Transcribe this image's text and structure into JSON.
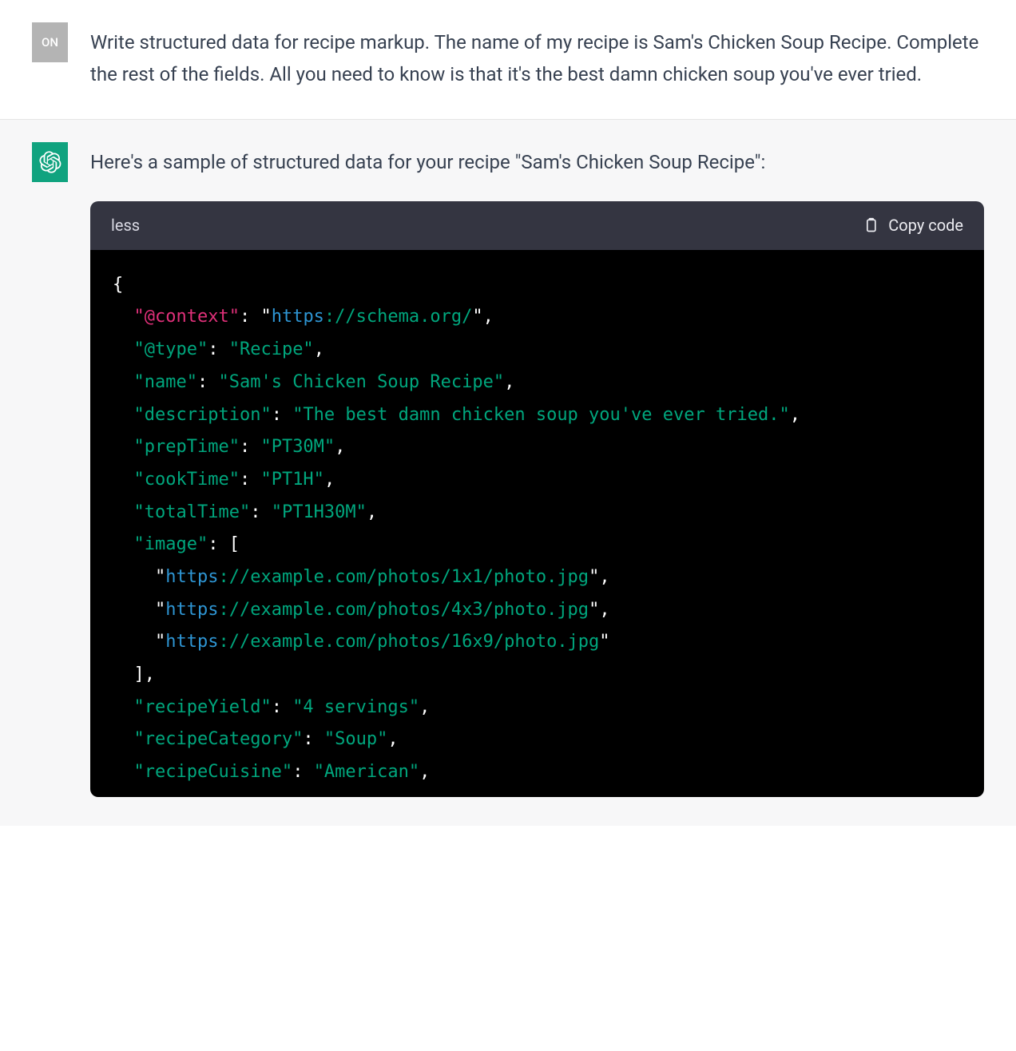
{
  "user": {
    "avatar_label": "ON",
    "text": "Write structured data for recipe markup. The name of my recipe is Sam's Chicken Soup Recipe. Complete the rest of the fields. All you need to know is that it's the best damn chicken soup you've ever tried."
  },
  "assistant": {
    "intro": "Here's a sample of structured data for your recipe \"Sam's Chicken Soup Recipe\":",
    "code_lang": "less",
    "copy_label": "Copy code",
    "code": {
      "context_key": "\"@context\"",
      "context_val": "\"https://schema.org/\"",
      "type_key": "\"@type\"",
      "type_val": "\"Recipe\"",
      "name_key": "\"name\"",
      "name_val": "\"Sam's Chicken Soup Recipe\"",
      "desc_key": "\"description\"",
      "desc_val": "\"The best damn chicken soup you've ever tried.\"",
      "prep_key": "\"prepTime\"",
      "prep_val": "\"PT30M\"",
      "cook_key": "\"cookTime\"",
      "cook_val": "\"PT1H\"",
      "total_key": "\"totalTime\"",
      "total_val": "\"PT1H30M\"",
      "image_key": "\"image\"",
      "image_0": "\"https://example.com/photos/1x1/photo.jpg\"",
      "image_1": "\"https://example.com/photos/4x3/photo.jpg\"",
      "image_2": "\"https://example.com/photos/16x9/photo.jpg\"",
      "yield_key": "\"recipeYield\"",
      "yield_val": "\"4 servings\"",
      "cat_key": "\"recipeCategory\"",
      "cat_val": "\"Soup\"",
      "cui_key": "\"recipeCuisine\"",
      "cui_val": "\"American\""
    }
  }
}
